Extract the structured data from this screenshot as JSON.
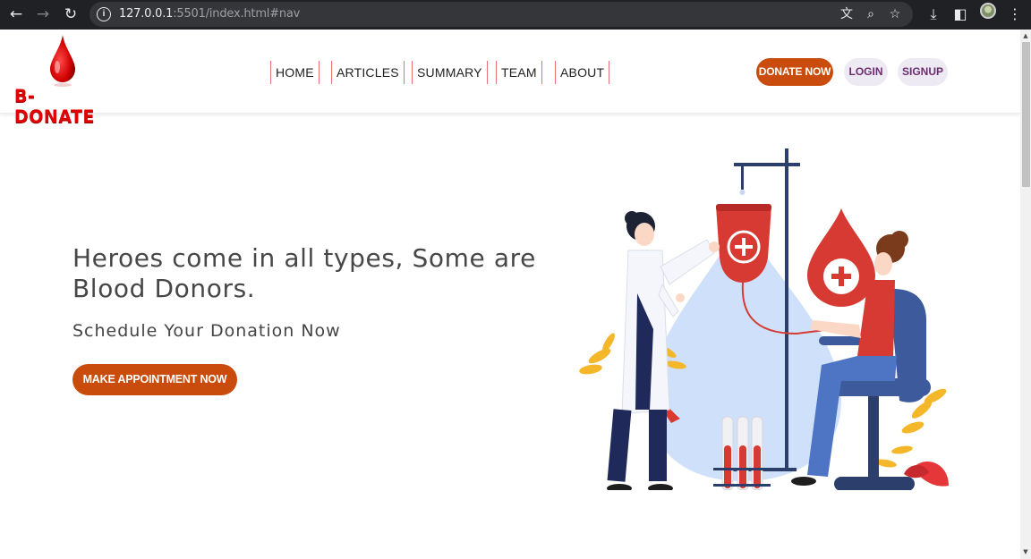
{
  "browser": {
    "url_host": "127.0.0.1",
    "url_rest": ":5501/index.html#nav"
  },
  "logo": {
    "text": "B-DONATE"
  },
  "nav": {
    "items": [
      {
        "label": "HOME"
      },
      {
        "label": "ARTICLES"
      },
      {
        "label": "SUMMARY"
      },
      {
        "label": "TEAM"
      },
      {
        "label": "ABOUT"
      }
    ]
  },
  "actions": {
    "donate_label": "DONATE NOW",
    "login_label": "LOGIN",
    "signup_label": "SIGNUP"
  },
  "hero": {
    "title": "Heroes come in all types, Some are Blood Donors.",
    "subtitle": "Schedule Your Donation Now",
    "cta_label": "MAKE APPOINTMENT NOW"
  },
  "colors": {
    "brand_orange": "#c94c0c",
    "brand_red": "#e00000",
    "nav_divider": "#e57373"
  }
}
